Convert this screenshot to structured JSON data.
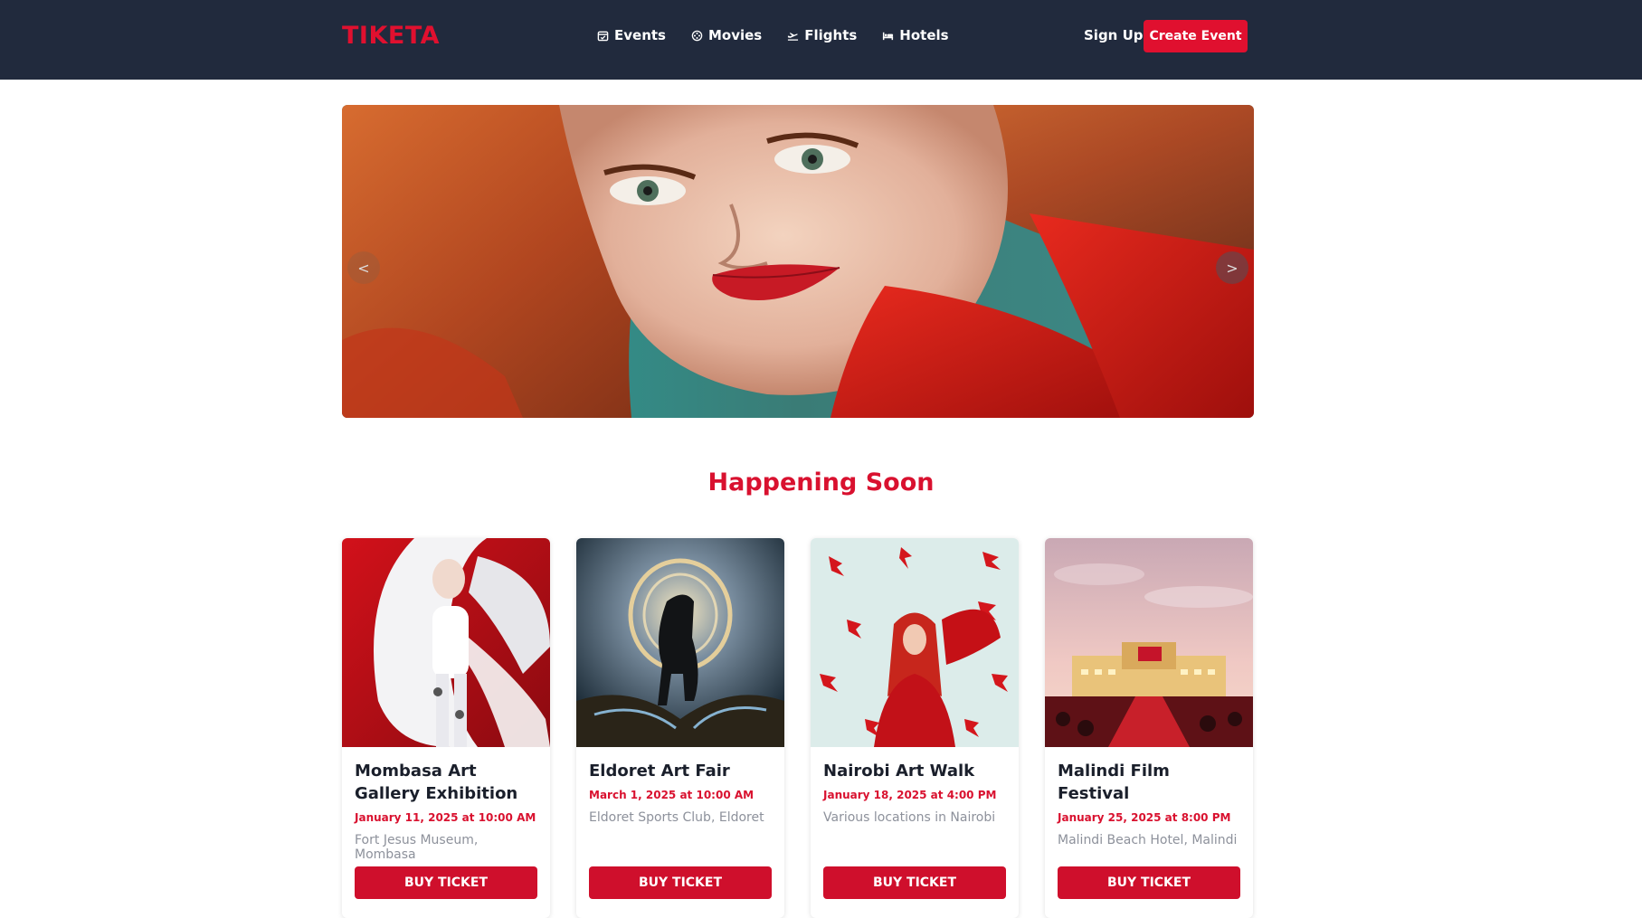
{
  "brand": {
    "name": "TIKETA",
    "accent": "#e0102f",
    "nav_bg": "#212a3d"
  },
  "nav": {
    "items": [
      {
        "label": "Events",
        "icon": "calendar-icon"
      },
      {
        "label": "Movies",
        "icon": "film-reel-icon"
      },
      {
        "label": "Flights",
        "icon": "plane-icon"
      },
      {
        "label": "Hotels",
        "icon": "bed-icon"
      }
    ],
    "signup_label": "Sign Up",
    "create_label": "Create Event"
  },
  "hero": {
    "prev_label": "<",
    "next_label": ">"
  },
  "section": {
    "title": "Happening Soon"
  },
  "events": [
    {
      "title": "Mombasa Art Gallery Exhibition",
      "date": "January 11, 2025 at 10:00 AM",
      "venue": "Fort Jesus Museum, Mombasa",
      "button": "BUY TICKET"
    },
    {
      "title": "Eldoret Art Fair",
      "date": "March 1, 2025 at 10:00 AM",
      "venue": "Eldoret Sports Club, Eldoret",
      "button": "BUY TICKET"
    },
    {
      "title": "Nairobi Art Walk",
      "date": "January 18, 2025 at 4:00 PM",
      "venue": "Various locations in Nairobi",
      "button": "BUY TICKET"
    },
    {
      "title": "Malindi Film Festival",
      "date": "January 25, 2025 at 8:00 PM",
      "venue": "Malindi Beach Hotel, Malindi",
      "button": "BUY TICKET"
    }
  ]
}
